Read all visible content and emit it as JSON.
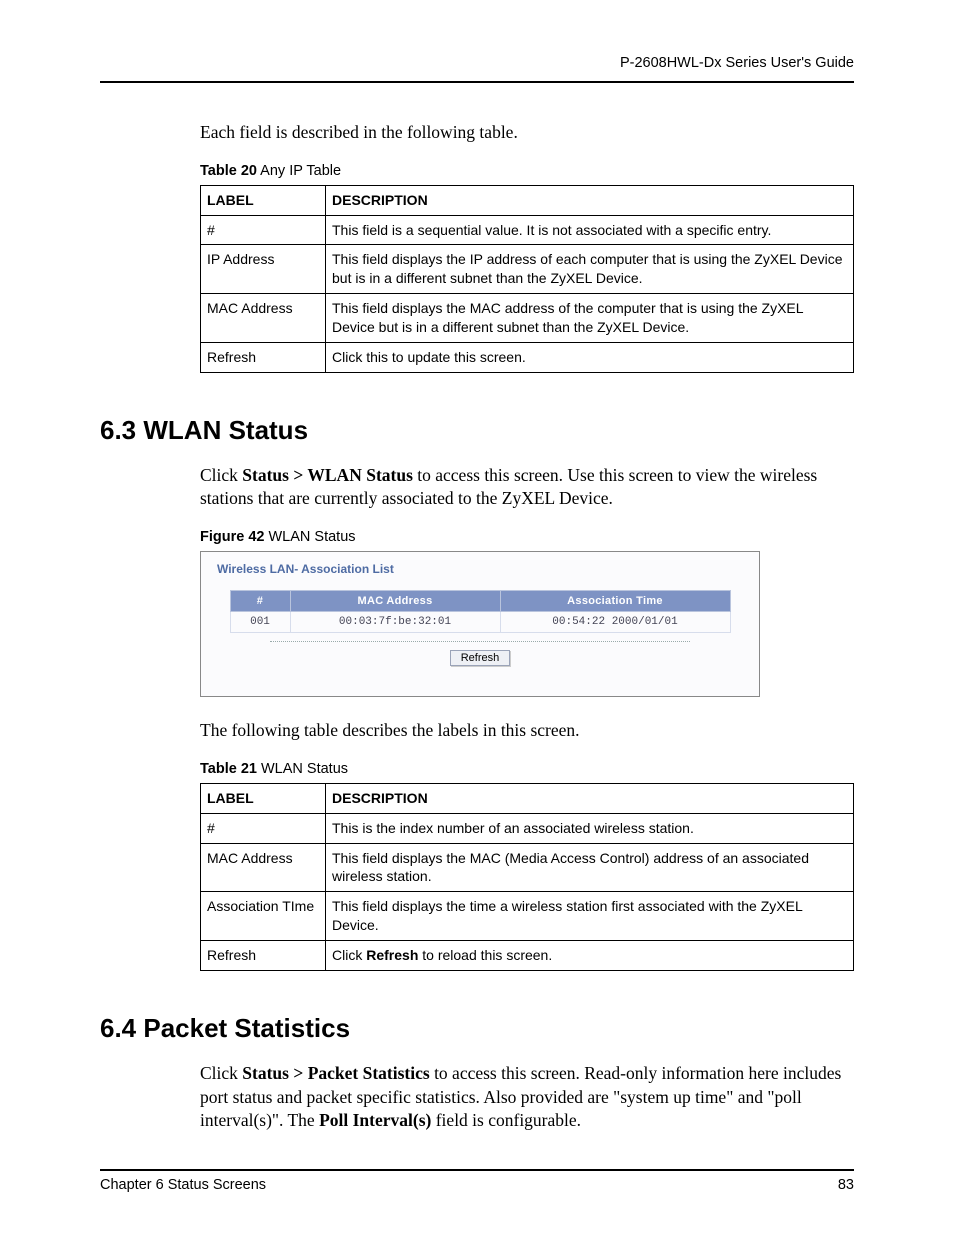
{
  "runningHead": "P-2608HWL-Dx Series User's Guide",
  "intro1": "Each field is described in the following table.",
  "table20": {
    "caption_b": "Table 20",
    "caption_r": "   Any IP Table",
    "h1": "LABEL",
    "h2": "DESCRIPTION",
    "rows": [
      {
        "label": "#",
        "desc": "This field is a sequential value. It is not associated with a specific entry."
      },
      {
        "label": "IP Address",
        "desc": "This field displays the IP address of each computer that is using the ZyXEL Device but is in a different subnet than the ZyXEL Device."
      },
      {
        "label": "MAC Address",
        "desc": "This field displays the MAC address of the computer that is using the ZyXEL Device but is in a different subnet than the ZyXEL Device."
      },
      {
        "label": "Refresh",
        "desc": "Click this to update this screen."
      }
    ]
  },
  "sec63": {
    "heading": "6.3  WLAN Status",
    "p_parts": [
      "Click ",
      "Status > WLAN Status",
      " to access this screen. Use this screen to view the wireless stations that are currently associated to the ZyXEL Device."
    ]
  },
  "fig42": {
    "caption_b": "Figure 42",
    "caption_r": "   WLAN Status",
    "panel_title": "Wireless LAN- Association List",
    "headers": [
      "#",
      "MAC Address",
      "Association Time"
    ],
    "row": [
      "001",
      "00:03:7f:be:32:01",
      "00:54:22 2000/01/01"
    ],
    "refresh": "Refresh"
  },
  "afterFig": "The following table describes the labels in this screen.",
  "table21": {
    "caption_b": "Table 21",
    "caption_r": "   WLAN Status",
    "h1": "LABEL",
    "h2": "DESCRIPTION",
    "rows": [
      {
        "label": "#",
        "desc": "This is the index number of an associated wireless station."
      },
      {
        "label": "MAC Address",
        "desc": "This field displays the MAC (Media Access Control) address of an associated wireless station."
      },
      {
        "label": "Association TIme",
        "desc": "This field displays the time a wireless station first associated with the ZyXEL Device."
      },
      {
        "label": "Refresh",
        "desc_parts": [
          "Click ",
          "Refresh",
          " to reload this screen."
        ]
      }
    ]
  },
  "sec64": {
    "heading": "6.4  Packet Statistics",
    "p_parts": [
      "Click ",
      "Status > Packet Statistics",
      " to access this screen. Read-only information here includes port status and packet specific statistics. Also provided are \"system up time\" and \"poll interval(s)\". The ",
      "Poll Interval(s)",
      " field is configurable."
    ]
  },
  "footer": {
    "chapter": "Chapter 6 Status Screens",
    "page": "83"
  }
}
